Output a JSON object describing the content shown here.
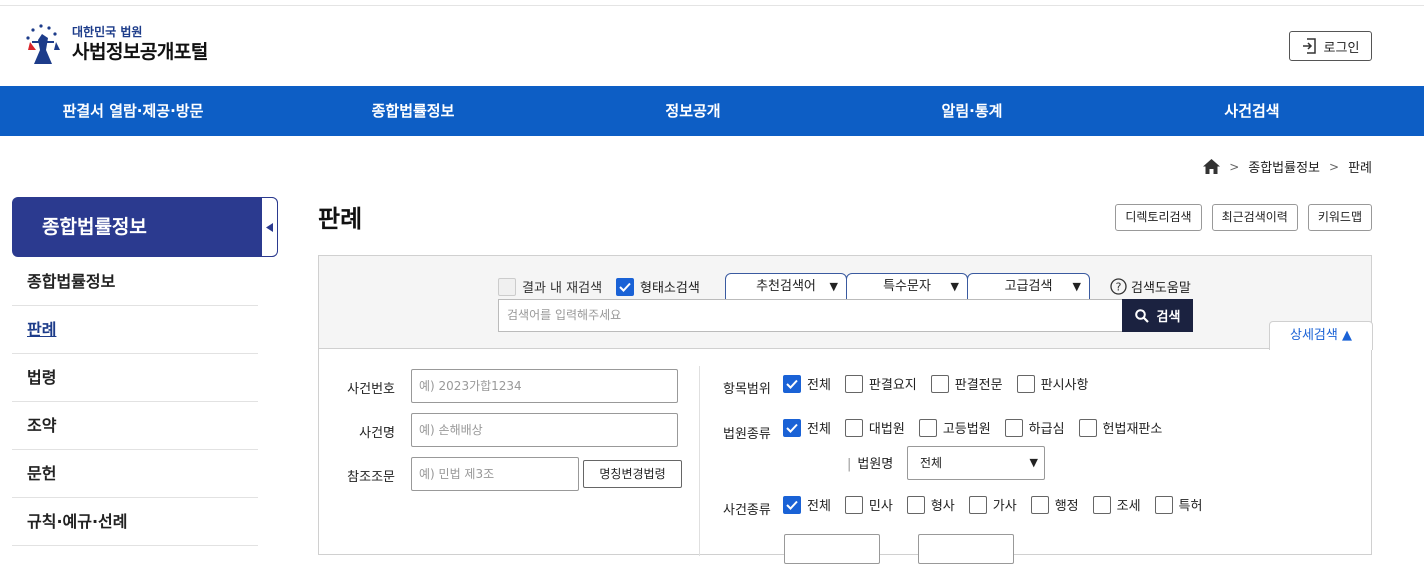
{
  "header": {
    "logo_sub": "대한민국 법원",
    "logo_main": "사법정보공개포털",
    "login_label": "로그인"
  },
  "nav": {
    "items": [
      {
        "label": "판결서 열람·제공·방문"
      },
      {
        "label": "종합법률정보"
      },
      {
        "label": "정보공개"
      },
      {
        "label": "알림·통계"
      },
      {
        "label": "사건검색"
      }
    ]
  },
  "breadcrumb": [
    "종합법률정보",
    "판례"
  ],
  "sidebar": {
    "title": "종합법률정보",
    "items": [
      {
        "label": "종합법률정보"
      },
      {
        "label": "판례"
      },
      {
        "label": "법령"
      },
      {
        "label": "조약"
      },
      {
        "label": "문헌"
      },
      {
        "label": "규칙·예규·선례"
      }
    ]
  },
  "main": {
    "title": "판례",
    "buttons": {
      "directory": "디렉토리검색",
      "recent": "최근검색이력",
      "keyword": "키워드맵"
    }
  },
  "search": {
    "within_results": "결과 내 재검색",
    "morpheme": "형태소검색",
    "recommend": "추천검색어",
    "special_chars": "특수문자",
    "advanced": "고급검색",
    "help": "검색도움말",
    "placeholder": "검색어를 입력해주세요",
    "button": "검색",
    "detail_tab": "상세검색 ▲"
  },
  "detail": {
    "case_no_label": "사건번호",
    "case_no_placeholder": "예) 2023가합1234",
    "case_name_label": "사건명",
    "case_name_placeholder": "예) 손해배상",
    "ref_label": "참조조문",
    "ref_placeholder": "예) 민법 제3조",
    "renamed_law_button": "명칭변경법령",
    "scope_label": "항목범위",
    "scope_options": [
      "전체",
      "판결요지",
      "판결전문",
      "판시사항"
    ],
    "court_type_label": "법원종류",
    "court_type_options": [
      "전체",
      "대법원",
      "고등법원",
      "하급심",
      "헌법재판소"
    ],
    "court_name_label": "법원명",
    "court_name_value": "전체",
    "case_type_label": "사건종류",
    "case_type_options": [
      "전체",
      "민사",
      "형사",
      "가사",
      "행정",
      "조세",
      "특허"
    ]
  },
  "colors": {
    "nav_bg": "#0d5ec5",
    "side_head_bg": "#2b3a8f",
    "check_on": "#1a62d6",
    "search_btn": "#1b2240"
  }
}
